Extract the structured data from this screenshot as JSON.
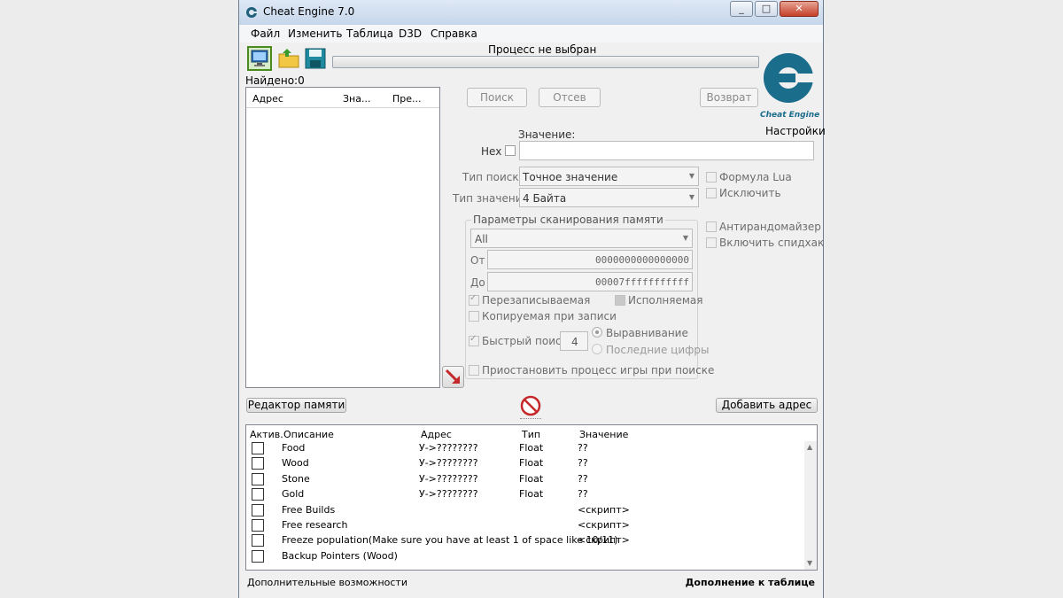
{
  "window": {
    "title": "Cheat Engine 7.0",
    "minimize": "0",
    "maximize": "1",
    "close": "X"
  },
  "menu": [
    "Файл",
    "Изменить",
    "Таблица",
    "D3D",
    "Справка"
  ],
  "toolbar": {
    "process_label": "Процесс не выбран",
    "found": "Найдено:0"
  },
  "results": {
    "columns": [
      "Адрес",
      "Зна...",
      "Пре..."
    ]
  },
  "scan": {
    "first_scan": "Поиск",
    "next_scan": "Отсев",
    "undo_scan": "Возврат",
    "settings": "Настройки",
    "value_label": "Значение:",
    "hex_label": "Hex",
    "scan_type_label": "Тип поиска",
    "scan_type_value": "Точное значение",
    "value_type_label": "Тип значения",
    "value_type_value": "4 Байта",
    "lua_formula": "Формула Lua",
    "exclude": "Исключить",
    "anti_random": "Антирандомайзер",
    "speedhack": "Включить спидхак",
    "memory_group_title": "Параметры сканирования памяти",
    "region_value": "All",
    "from_label": "От",
    "from_value": "0000000000000000",
    "to_label": "До",
    "to_value": "00007fffffffffff",
    "writable": "Перезаписываемая",
    "executable": "Исполняемая",
    "copy_on_write": "Копируемая при записи",
    "fast_scan": "Быстрый поиск",
    "fast_scan_value": "4",
    "alignment": "Выравнивание",
    "last_digits": "Последние цифры",
    "pause_game": "Приостановить процесс игры при поиске"
  },
  "actions": {
    "memory_view": "Редактор памяти",
    "add_address": "Добавить адрес"
  },
  "table": {
    "columns": {
      "active": "Актив.",
      "description": "Описание",
      "address": "Адрес",
      "type": "Тип",
      "value": "Значение"
    },
    "rows": [
      {
        "description": "Food",
        "address": "У->????????",
        "type": "Float",
        "value": "??"
      },
      {
        "description": "Wood",
        "address": "У->????????",
        "type": "Float",
        "value": "??"
      },
      {
        "description": "Stone",
        "address": "У->????????",
        "type": "Float",
        "value": "??"
      },
      {
        "description": "Gold",
        "address": "У->????????",
        "type": "Float",
        "value": "??"
      },
      {
        "description": "Free Builds",
        "address": "",
        "type": "",
        "value": "<скрипт>"
      },
      {
        "description": "Free research",
        "address": "",
        "type": "",
        "value": "<скрипт>"
      },
      {
        "description": "Freeze population(Make sure you have at least 1 of space like 10/11)",
        "address": "",
        "type": "",
        "value": "<скрипт>"
      },
      {
        "description": "Backup Pointers (Wood)",
        "address": "",
        "type": "",
        "value": ""
      }
    ]
  },
  "status": {
    "left": "Дополнительные возможности",
    "right": "Дополнение к таблице"
  },
  "logo": {
    "text": "Cheat Engine"
  }
}
